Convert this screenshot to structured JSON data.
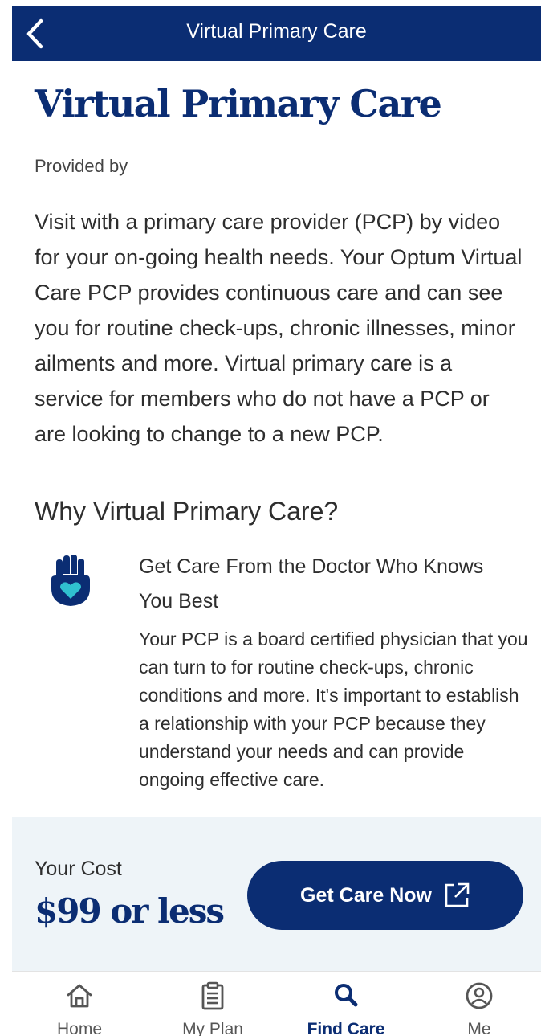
{
  "header": {
    "title": "Virtual Primary Care",
    "back_icon": "chevron-left-icon"
  },
  "page": {
    "title": "Virtual Primary Care",
    "provided_by": "Provided by",
    "intro": "Visit with a primary care provider (PCP) by video for your on-going health needs. Your Optum Virtual Care PCP provides continuous care and can see you for routine check-ups, chronic illnesses, minor ailments and more. Virtual primary care is a service for members who do not have a PCP or are looking to change to a new PCP.",
    "why_heading": "Why Virtual Primary Care?",
    "benefit": {
      "icon": "hand-heart-icon",
      "title": "Get Care From the Doctor Who Knows You Best",
      "body": "Your PCP is a board certified physician that you can turn to for routine check-ups, chronic conditions and more. It's important to establish a relationship with your PCP because they understand your needs and can provide ongoing effective care."
    }
  },
  "cost": {
    "label": "Your Cost",
    "value": "$99 or less",
    "button_label": "Get Care Now",
    "button_icon": "external-link-icon"
  },
  "tabs": [
    {
      "label": "Home",
      "icon": "home-icon",
      "active": false
    },
    {
      "label": "My Plan",
      "icon": "clipboard-icon",
      "active": false
    },
    {
      "label": "Find Care",
      "icon": "search-icon",
      "active": true
    },
    {
      "label": "Me",
      "icon": "user-icon",
      "active": false
    }
  ],
  "colors": {
    "brand_navy": "#0b2d73",
    "accent_teal": "#30c1cf",
    "cost_panel_bg": "#eef4f8"
  }
}
